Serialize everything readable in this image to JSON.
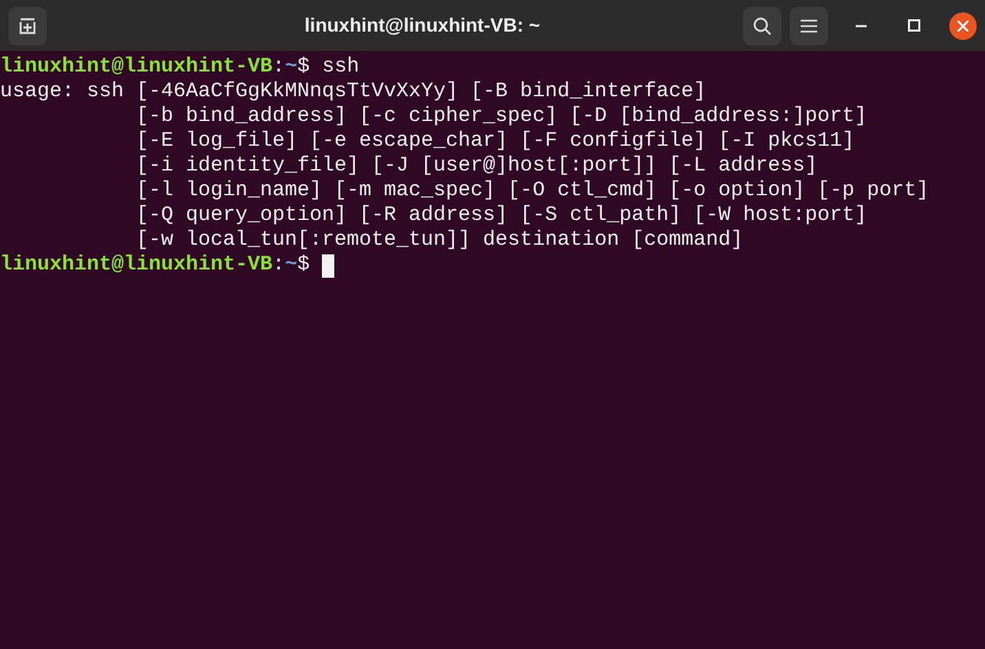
{
  "window": {
    "title": "linuxhint@linuxhint-VB: ~"
  },
  "terminal": {
    "lines": [
      {
        "kind": "prompt",
        "user_host": "linuxhint@linuxhint-VB",
        "separator": ":",
        "path": "~",
        "symbol": "$",
        "command": " ssh",
        "cursor": false
      },
      {
        "kind": "output",
        "text": "usage: ssh [-46AaCfGgKkMNnqsTtVvXxYy] [-B bind_interface]"
      },
      {
        "kind": "output",
        "text": "           [-b bind_address] [-c cipher_spec] [-D [bind_address:]port]"
      },
      {
        "kind": "output",
        "text": "           [-E log_file] [-e escape_char] [-F configfile] [-I pkcs11]"
      },
      {
        "kind": "output",
        "text": "           [-i identity_file] [-J [user@]host[:port]] [-L address]"
      },
      {
        "kind": "output",
        "text": "           [-l login_name] [-m mac_spec] [-O ctl_cmd] [-o option] [-p port]"
      },
      {
        "kind": "output",
        "text": "           [-Q query_option] [-R address] [-S ctl_path] [-W host:port]"
      },
      {
        "kind": "output",
        "text": "           [-w local_tun[:remote_tun]] destination [command]"
      },
      {
        "kind": "prompt",
        "user_host": "linuxhint@linuxhint-VB",
        "separator": ":",
        "path": "~",
        "symbol": "$",
        "cursor": true
      }
    ]
  }
}
